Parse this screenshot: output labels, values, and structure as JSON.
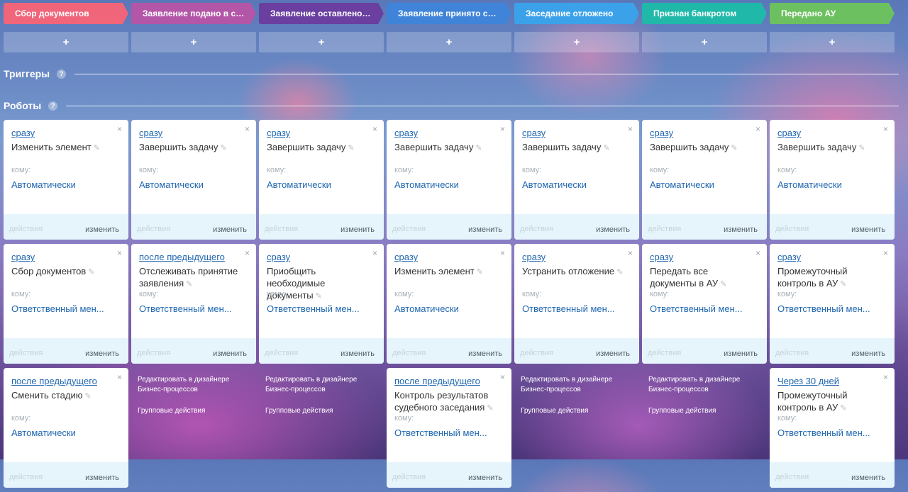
{
  "stages": [
    {
      "label": "Сбор документов",
      "color": "#f0657a"
    },
    {
      "label": "Заявление подано в суд",
      "color": "#b456a8"
    },
    {
      "label": "Заявление оставлено без движения",
      "color": "#6a3fa0"
    },
    {
      "label": "Заявление принято судом",
      "color": "#3f84d8"
    },
    {
      "label": "Заседание отложено",
      "color": "#3ba2ea"
    },
    {
      "label": "Признан банкротом",
      "color": "#20b9a9"
    },
    {
      "label": "Передано АУ",
      "color": "#6cc05f"
    }
  ],
  "add_label": "+",
  "sections": {
    "triggers": "Триггеры",
    "robots": "Роботы",
    "help": "?"
  },
  "card_labels": {
    "to_whom": "кому:",
    "actions": "действия",
    "edit": "изменить",
    "close": "×",
    "pencil": "✎"
  },
  "designer": {
    "edit": "Редактировать в дизайнере Бизнес-процессов",
    "group": "Групповые действия"
  },
  "robots": [
    [
      {
        "when": "сразу",
        "title": "Изменить элемент",
        "who": "Автоматически"
      },
      {
        "when": "сразу",
        "title": "Завершить задачу",
        "who": "Автоматически"
      },
      {
        "when": "сразу",
        "title": "Завершить задачу",
        "who": "Автоматически"
      },
      {
        "when": "сразу",
        "title": "Завершить задачу",
        "who": "Автоматически"
      },
      {
        "when": "сразу",
        "title": "Завершить задачу",
        "who": "Автоматически"
      },
      {
        "when": "сразу",
        "title": "Завершить задачу",
        "who": "Автоматически"
      },
      {
        "when": "сразу",
        "title": "Завершить задачу",
        "who": "Автоматически"
      }
    ],
    [
      {
        "when": "сразу",
        "title": "Сбор документов",
        "who": "Ответственный мен..."
      },
      {
        "when": "после предыдущего",
        "title": "Отслеживать принятие заявления",
        "who": "Ответственный мен..."
      },
      {
        "when": "сразу",
        "title": "Приобщить необходимые документы",
        "who": "Ответственный мен..."
      },
      {
        "when": "сразу",
        "title": "Изменить элемент",
        "who": "Автоматически"
      },
      {
        "when": "сразу",
        "title": "Устранить отложение",
        "who": "Ответственный мен..."
      },
      {
        "when": "сразу",
        "title": "Передать все документы в АУ",
        "who": "Ответственный мен..."
      },
      {
        "when": "сразу",
        "title": "Промежуточный контроль в АУ",
        "who": "Ответственный мен..."
      }
    ],
    [
      {
        "when": "после предыдущего",
        "title": "Сменить стадию",
        "who": "Автоматически"
      },
      null,
      null,
      {
        "when": "после предыдущего",
        "title": "Контроль результатов судебного заседания",
        "who": "Ответственный мен..."
      },
      null,
      null,
      {
        "when": "Через 30 дней",
        "title": "Промежуточный контроль в АУ",
        "who": "Ответственный мен..."
      }
    ]
  ]
}
